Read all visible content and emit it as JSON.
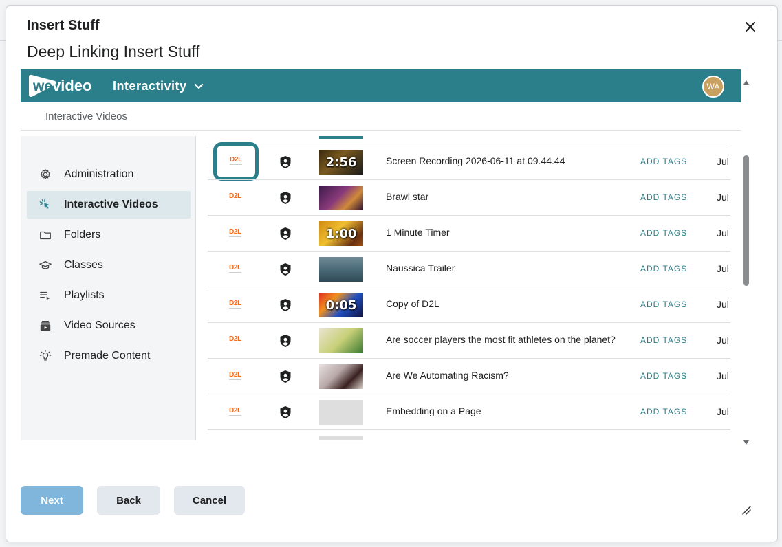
{
  "dialog": {
    "title": "Insert Stuff",
    "subtitle": "Deep Linking Insert Stuff"
  },
  "app": {
    "logo_text": "wevideo",
    "product": "Interactivity",
    "avatar_initials": "WA",
    "brand_color": "#2b7f8b",
    "breadcrumb": "Interactive Videos"
  },
  "sidebar": {
    "items": [
      {
        "label": "Administration",
        "icon": "gear-icon"
      },
      {
        "label": "Interactive Videos",
        "icon": "pointer-click-icon",
        "active": true
      },
      {
        "label": "Folders",
        "icon": "folder-icon"
      },
      {
        "label": "Classes",
        "icon": "graduation-cap-icon"
      },
      {
        "label": "Playlists",
        "icon": "playlist-icon"
      },
      {
        "label": "Video Sources",
        "icon": "video-sources-icon"
      },
      {
        "label": "Premade Content",
        "icon": "lightbulb-icon"
      }
    ]
  },
  "videos": {
    "lti_label": "D2L",
    "add_tags_label": "ADD TAGS",
    "rows": [
      {
        "title": "Screen Recording 2026-06-11 at 09.44.44",
        "duration": "2:56",
        "date": "Jul",
        "thumb": "dark",
        "selected": true
      },
      {
        "title": "Brawl star",
        "duration": "",
        "date": "Jul",
        "thumb": "purple"
      },
      {
        "title": "1 Minute Timer",
        "duration": "1:00",
        "date": "Jul",
        "thumb": "orange"
      },
      {
        "title": "Naussica Trailer",
        "duration": "",
        "date": "Jul",
        "thumb": "sea"
      },
      {
        "title": "Copy of D2L",
        "duration": "0:05",
        "date": "Jul",
        "thumb": "colorful"
      },
      {
        "title": "Are soccer players the most fit athletes on the planet?",
        "duration": "",
        "date": "Jul",
        "thumb": "soccer"
      },
      {
        "title": "Are We Automating Racism?",
        "duration": "",
        "date": "Jul",
        "thumb": "person"
      },
      {
        "title": "Embedding on a Page",
        "duration": "",
        "date": "Jul",
        "thumb": "blank"
      }
    ]
  },
  "footer": {
    "next": "Next",
    "back": "Back",
    "cancel": "Cancel"
  }
}
